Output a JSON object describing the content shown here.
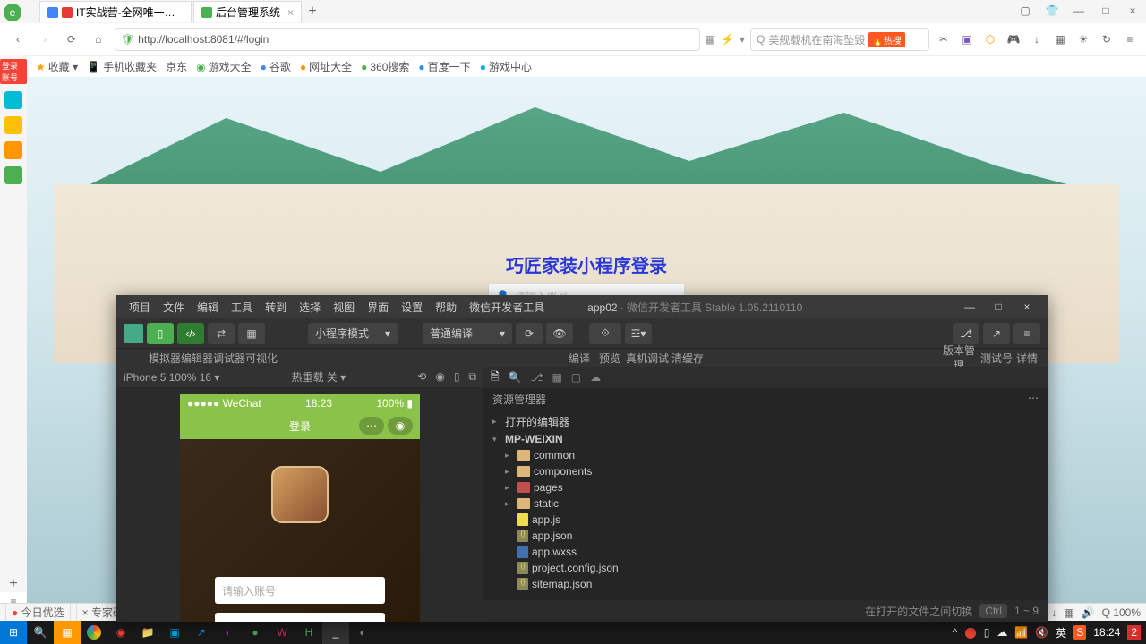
{
  "browser": {
    "tabs": [
      {
        "title": "IT实战营-全网唯一集免费查重",
        "icon": "#e53935"
      },
      {
        "title": "后台管理系统",
        "icon": "#4caf50"
      }
    ],
    "url": "http://localhost:8081/#/login",
    "search_placeholder": "美舰载机在南海坠毁",
    "hot_label": "🔥热搜",
    "bookmarks": [
      "收藏 ▾",
      "手机收藏夹",
      "京东",
      "游戏大全",
      "谷歌",
      "网址大全",
      "360搜索",
      "百度一下",
      "游戏中心"
    ]
  },
  "page": {
    "login_title": "巧匠家装小程序登录",
    "username_ph": "请输入账号"
  },
  "devtools": {
    "menu": [
      "项目",
      "文件",
      "编辑",
      "工具",
      "转到",
      "选择",
      "视图",
      "界面",
      "设置",
      "帮助",
      "微信开发者工具"
    ],
    "title_app": "app02",
    "title_suffix": "- 微信开发者工具 Stable 1.05.2110110",
    "mode_select": "小程序模式",
    "compile_select": "普通编译",
    "toolbar_labels": {
      "sim": "模拟器",
      "editor": "编辑器",
      "debugger": "调试器",
      "visual": "可视化",
      "compile": "编译",
      "preview": "预览",
      "realdevice": "真机调试",
      "clearcache": "清缓存",
      "version": "版本管理",
      "testid": "测试号",
      "detail": "详情"
    },
    "sim": {
      "device": "iPhone 5 100% 16 ▾",
      "hotreload": "热重载 关 ▾"
    },
    "phone": {
      "carrier": "●●●●● WeChat",
      "time": "18:23",
      "battery": "100%",
      "nav_title": "登录",
      "input_ph": "请输入账号"
    },
    "explorer": {
      "title": "资源管理器",
      "sections": {
        "opened": "打开的编辑器",
        "project": "MP-WEIXIN"
      },
      "folders": [
        "common",
        "components",
        "pages",
        "static"
      ],
      "files": [
        "app.js",
        "app.json",
        "app.wxss",
        "project.config.json",
        "sitemap.json"
      ]
    },
    "status": {
      "hint": "在打开的文件之间切换",
      "kbd1": "Ctrl",
      "kbd2": "1 ~ 9"
    }
  },
  "status_bar": {
    "left": [
      "今日优选",
      "专家研究:"
    ],
    "zoom": "100%"
  },
  "taskbar": {
    "time": "18:24",
    "ime": "英"
  }
}
